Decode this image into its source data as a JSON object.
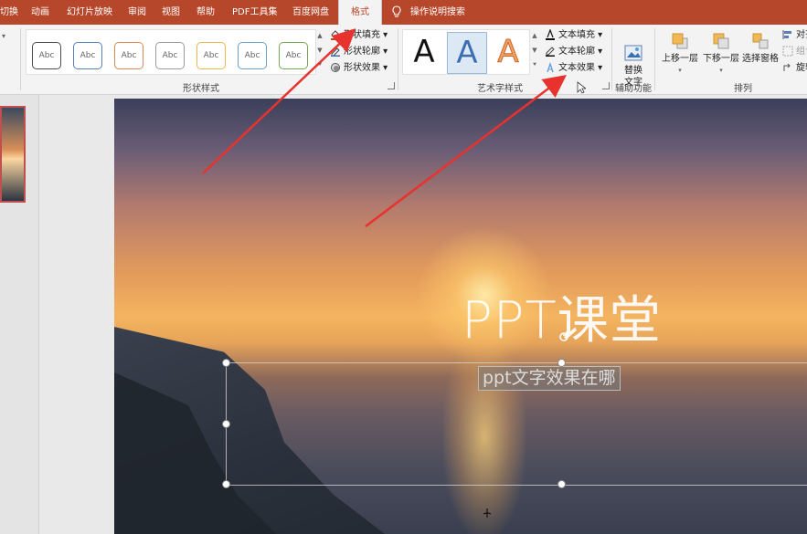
{
  "menubar": {
    "tabs": [
      "切换",
      "动画",
      "幻灯片放映",
      "审阅",
      "视图",
      "帮助",
      "PDF工具集",
      "百度网盘",
      "格式"
    ],
    "active_tab": "格式",
    "tell_me": "操作说明搜索"
  },
  "ribbon": {
    "shape_styles": {
      "label": "形状样式",
      "preset_text": "Abc",
      "preset_colors": [
        "#4a4a4a",
        "#5b7db8",
        "#e0864b",
        "#9a9a9a",
        "#e8b84a",
        "#6a9fc6",
        "#78a84d"
      ],
      "fill": "形状填充",
      "outline": "形状轮廓",
      "effects": "形状效果"
    },
    "wordart": {
      "label": "艺术字样式",
      "sample": "A",
      "text_fill": "文本填充",
      "text_outline": "文本轮廓",
      "text_effects": "文本效果"
    },
    "accessibility": {
      "label": "辅助功能",
      "alt_text": "替换\n文字"
    },
    "arrange": {
      "label": "排列",
      "bring_forward": "上移一层",
      "send_backward": "下移一层",
      "selection_pane": "选择窗格",
      "align": "对齐",
      "group": "组合",
      "rotate": "旋转"
    }
  },
  "slide": {
    "title": "PPT课堂",
    "subtitle": "ppt文字效果在哪"
  },
  "colors": {
    "accent": "#b7472a",
    "arrow": "#e8322d"
  }
}
